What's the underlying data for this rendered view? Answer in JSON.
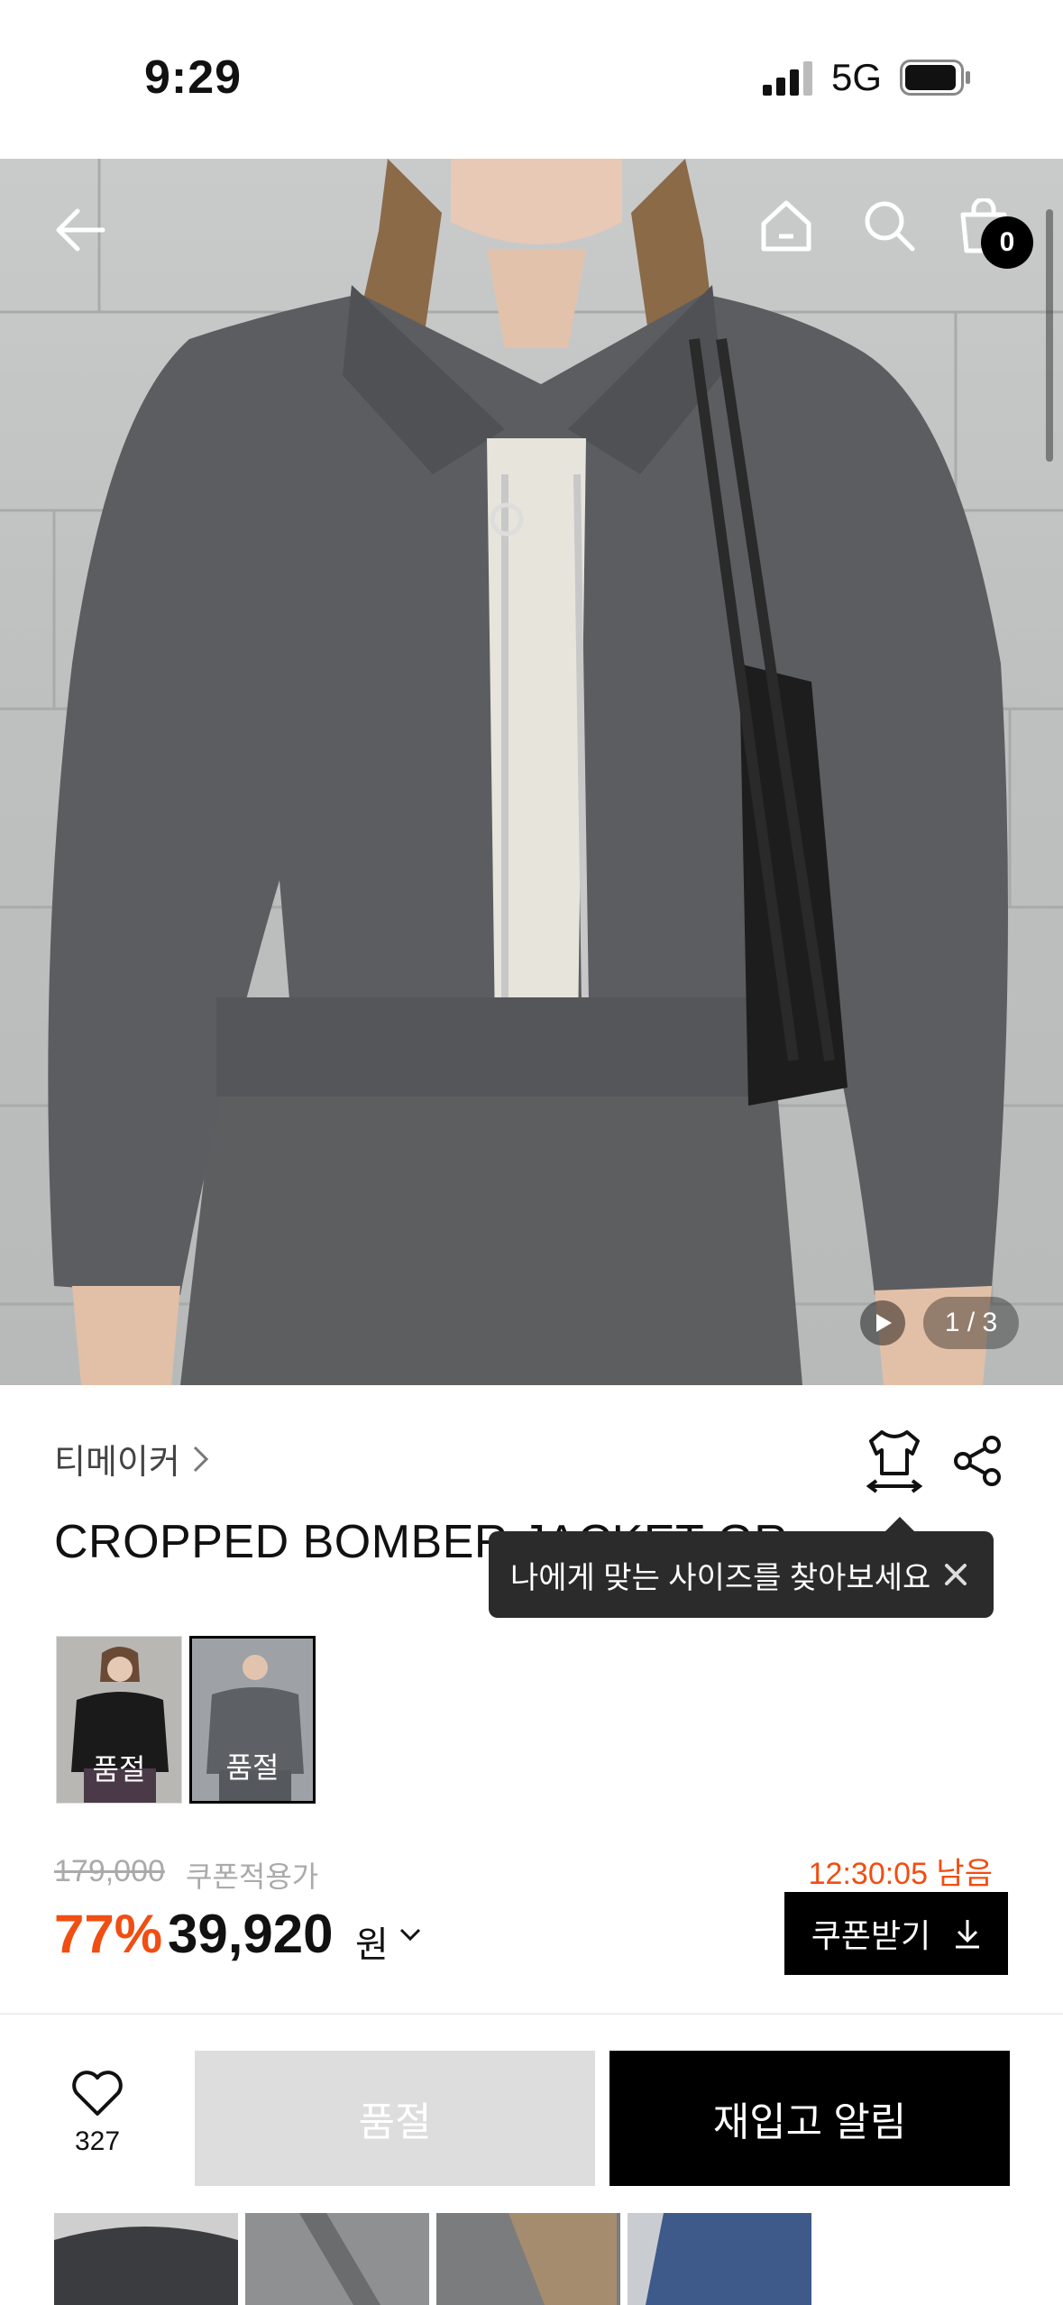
{
  "status_bar": {
    "time": "9:29",
    "network": "5G"
  },
  "nav": {
    "cart_count": "0"
  },
  "gallery": {
    "counter": "1 / 3"
  },
  "product": {
    "brand": "티메이커",
    "title": "CROPPED BOMBER JACKET GR",
    "tooltip": "나에게 맞는 사이즈를 찾아보세요",
    "color_options": [
      {
        "label": "품절"
      },
      {
        "label": "품절"
      }
    ],
    "original_price": "179,000",
    "coupon_label": "쿠폰적용가",
    "discount": "77%",
    "price": "39,920",
    "currency": "원",
    "timer": "12:30:05 남음",
    "coupon_button": "쿠폰받기"
  },
  "bottom_bar": {
    "like_count": "327",
    "sold_out_label": "품절",
    "restock_label": "재입고 알림"
  },
  "colors": {
    "accent": "#f04e12",
    "dark": "#000000",
    "disabled": "#dddddd"
  }
}
